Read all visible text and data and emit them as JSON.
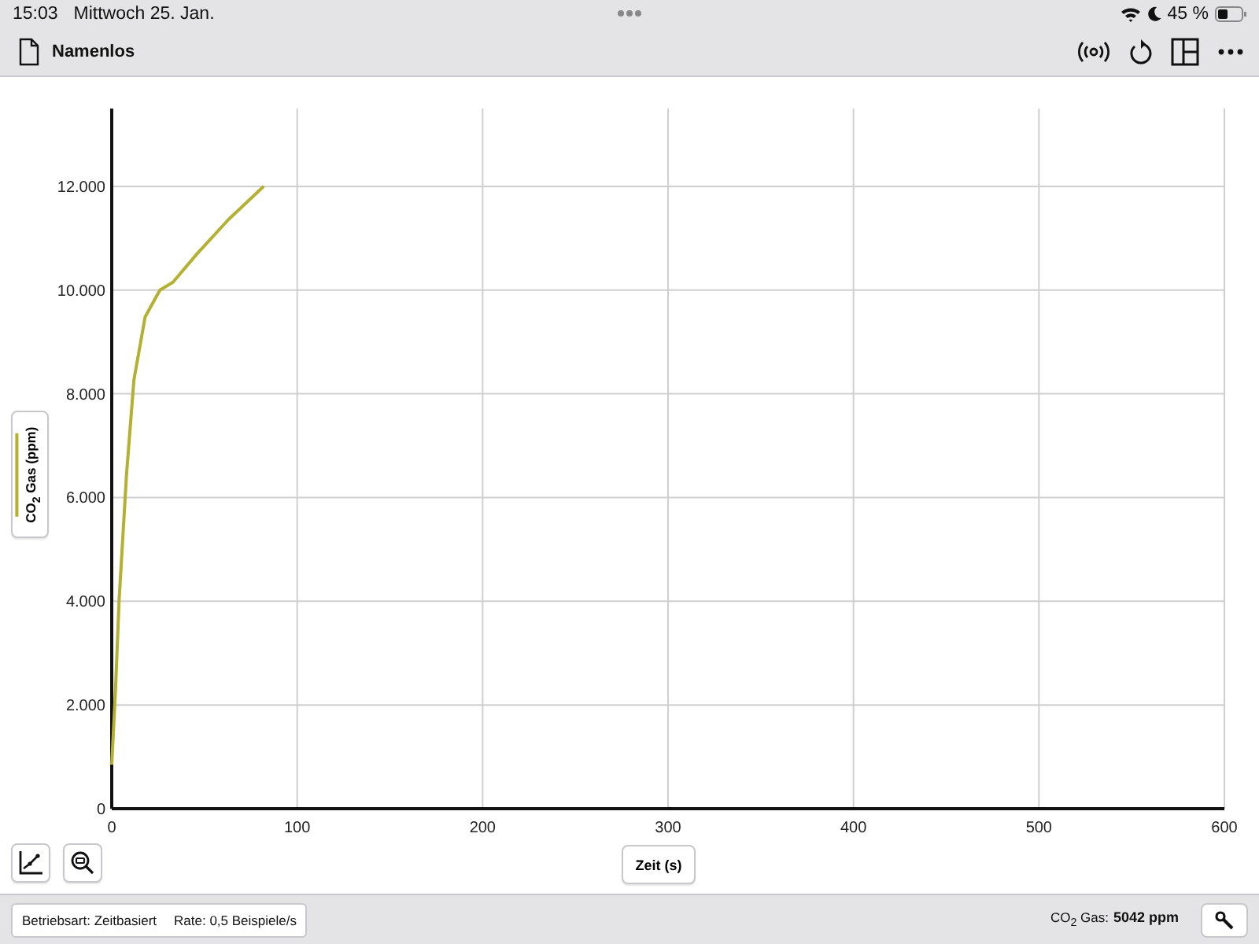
{
  "status_bar": {
    "time": "15:03",
    "date": "Mittwoch 25. Jan.",
    "battery": "45 %"
  },
  "toolbar": {
    "title": "Namenlos"
  },
  "graph": {
    "chart_data": {
      "type": "line",
      "grid": true,
      "xlabel": "Zeit (s)",
      "ylabel": "CO$_{2}$ Gas (ppm)",
      "xlim": [
        0,
        600
      ],
      "ylim": [
        0,
        13500
      ],
      "xticks": [
        0,
        100,
        200,
        300,
        400,
        500,
        600
      ],
      "yticks": [
        {
          "value": 0,
          "label": "0"
        },
        {
          "value": 2000,
          "label": "2.000"
        },
        {
          "value": 4000,
          "label": "4.000"
        },
        {
          "value": 6000,
          "label": "6.000"
        },
        {
          "value": 8000,
          "label": "8.000"
        },
        {
          "value": 10000,
          "label": "10.000"
        },
        {
          "value": 12000,
          "label": "12.000"
        }
      ],
      "x": [
        0,
        2,
        4,
        8,
        12,
        18,
        26,
        33,
        46,
        63,
        82
      ],
      "series": [
        {
          "color": "#b3b032",
          "values": [
            850,
            2300,
            4030,
            6450,
            8270,
            9480,
            10000,
            10150,
            10700,
            11360,
            12000
          ]
        }
      ]
    }
  },
  "footer": {
    "mode": "Betriebsart: Zeitbasiert",
    "rate": "Rate: 0,5 Beispiele/s",
    "reading_label": "CO$_{2}$ Gas:",
    "reading_value": "5042 ppm"
  }
}
